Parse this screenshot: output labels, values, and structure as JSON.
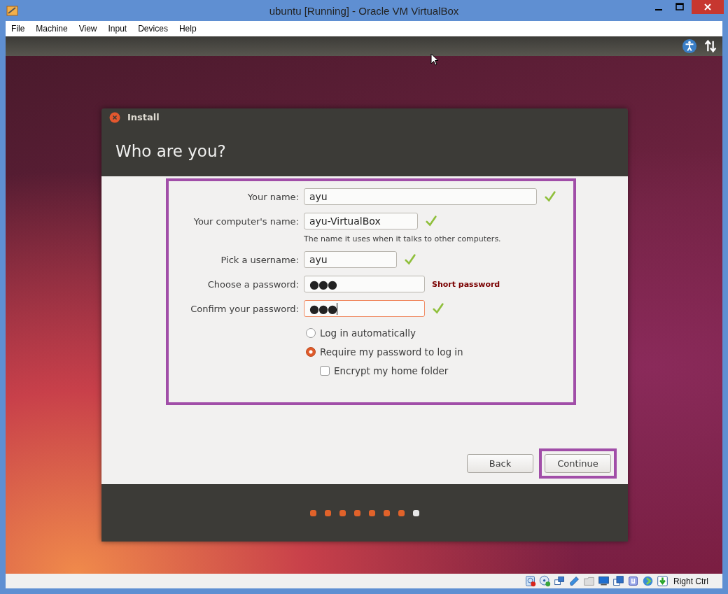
{
  "window": {
    "title": "ubuntu [Running] - Oracle VM VirtualBox"
  },
  "menu": [
    "File",
    "Machine",
    "View",
    "Input",
    "Devices",
    "Help"
  ],
  "dialog": {
    "title": "Install",
    "heading": "Who are you?",
    "fields": [
      {
        "label": "Your name:",
        "value": "ayu",
        "kind": "text",
        "valid": true,
        "focused": false
      },
      {
        "label": "Your computer's name:",
        "value": "ayu-VirtualBox",
        "kind": "text",
        "valid": true,
        "focused": false,
        "hint": "The name it uses when it talks to other computers."
      },
      {
        "label": "Pick a username:",
        "value": "ayu",
        "kind": "text",
        "valid": true,
        "focused": false
      },
      {
        "label": "Choose a password:",
        "value": "●●●",
        "kind": "password",
        "valid": false,
        "focused": false,
        "message": "Short password"
      },
      {
        "label": "Confirm your password:",
        "value": "●●●",
        "kind": "password",
        "valid": true,
        "focused": true
      }
    ],
    "options": [
      {
        "kind": "radio",
        "label": "Log in automatically",
        "selected": false
      },
      {
        "kind": "radio",
        "label": "Require my password to log in",
        "selected": true
      },
      {
        "kind": "checkbox",
        "label": "Encrypt my home folder",
        "checked": false
      }
    ],
    "buttons": [
      {
        "label": "Back",
        "highlighted": false
      },
      {
        "label": "Continue",
        "highlighted": true
      }
    ],
    "steps": [
      {
        "current": false
      },
      {
        "current": false
      },
      {
        "current": false
      },
      {
        "current": false
      },
      {
        "current": false
      },
      {
        "current": false
      },
      {
        "current": false
      },
      {
        "current": true
      }
    ]
  },
  "status_bar": {
    "host_key": "Right Ctrl"
  }
}
